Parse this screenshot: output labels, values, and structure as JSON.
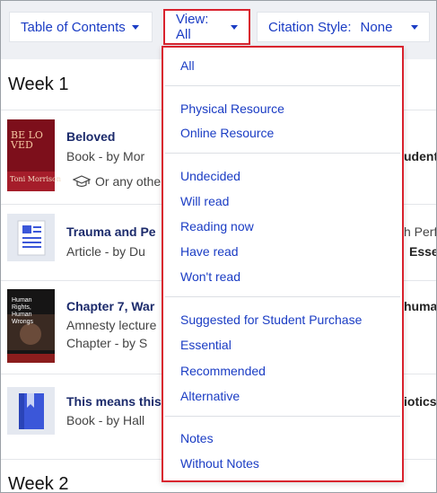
{
  "toolbar": {
    "toc_label": "Table of Contents",
    "view_label": "View: All",
    "citation_label": "Citation Style:",
    "citation_value": "None"
  },
  "sections": [
    {
      "label": "Week 1"
    },
    {
      "label": "Week 2"
    }
  ],
  "items": [
    {
      "title": "Beloved",
      "meta": "Book  -  by Mor",
      "extra": "Or any othe",
      "right": "udent",
      "thumb_text_top": "BE LO VED",
      "thumb_text_bottom": "Toni Morrison"
    },
    {
      "title": "Trauma and Pe",
      "meta": "Article  -  by Du",
      "right_top": "h Perf",
      "right": "Esse"
    },
    {
      "title": "Chapter 7, War",
      "meta": "Amnesty lecture",
      "meta2": "Chapter  -  by S",
      "right": "huma",
      "thumb_text": "Human Rights, Human Wrongs"
    },
    {
      "title": "This means this",
      "meta": "Book  -  by Hall",
      "right": "iotics"
    }
  ],
  "menu": {
    "groups": [
      [
        "All"
      ],
      [
        "Physical Resource",
        "Online Resource"
      ],
      [
        "Undecided",
        "Will read",
        "Reading now",
        "Have read",
        "Won't read"
      ],
      [
        "Suggested for Student Purchase",
        "Essential",
        "Recommended",
        "Alternative"
      ],
      [
        "Notes",
        "Without Notes"
      ]
    ]
  },
  "colors": {
    "accent": "#1a3cc4",
    "highlight_border": "#d9232e",
    "title_text": "#1b2a6b"
  },
  "icons": {
    "caret": "chevron-down-icon",
    "graduation": "graduation-cap-icon",
    "article": "article-icon",
    "book": "book-icon"
  }
}
